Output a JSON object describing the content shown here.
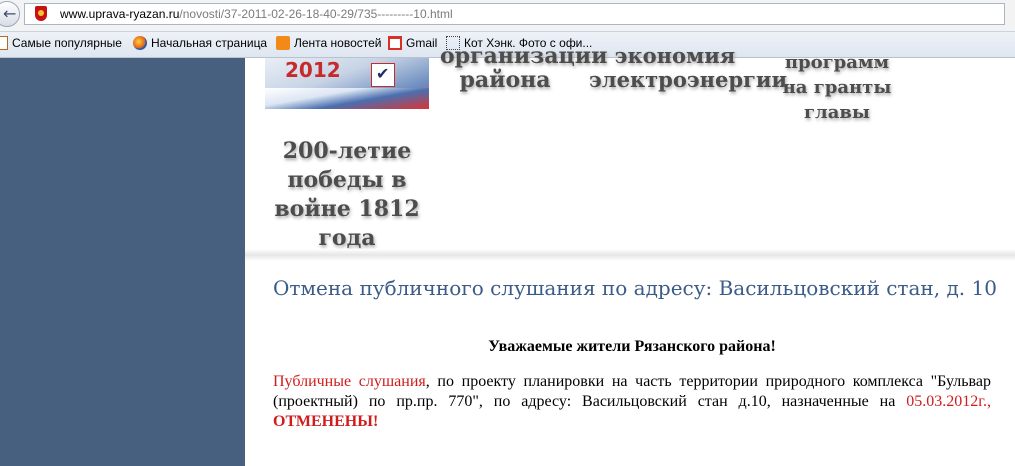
{
  "browser": {
    "url_domain": "www.uprava-ryazan.ru",
    "url_path": "/novosti/37-2011-02-26-18-40-29/735---------10.html",
    "back_icon": "arrow-left-icon"
  },
  "bookmarks": [
    {
      "label": "Самые популярные",
      "icon": "bookmark-star-icon"
    },
    {
      "label": "Начальная страница",
      "icon": "firefox-icon"
    },
    {
      "label": "Лента новостей",
      "icon": "rss-icon"
    },
    {
      "label": "Gmail",
      "icon": "gmail-icon"
    },
    {
      "label": "Кот Хэнк. Фото с офи...",
      "icon": "page-icon"
    }
  ],
  "site_menu": {
    "banner_year": "2012",
    "district": "района",
    "district_top": "организации",
    "energy": "электроэнергии",
    "energy_top": "экономия",
    "grants": "программ на гранты главы",
    "anniversary": "200-летие победы в войне 1812 года"
  },
  "article": {
    "title": "Отмена публичного слушания по адресу: Васильцовский стан, д. 10",
    "greeting": "Уважаемые жители Рязанского района!",
    "body_link": "Публичные слушания",
    "body_main": ", по проекту планировки на часть территории природного комплекса \"Бульвар (проектный) по пр.пр. 770\", по адресу: Васильцовский стан д.10, назначенные на ",
    "body_date": "05.03.2012г.,",
    "body_cancel": "ОТМЕНЕНЫ!"
  },
  "colors": {
    "sidebar": "#48607f",
    "title": "#3c5c88",
    "alert": "#d01c1c"
  }
}
